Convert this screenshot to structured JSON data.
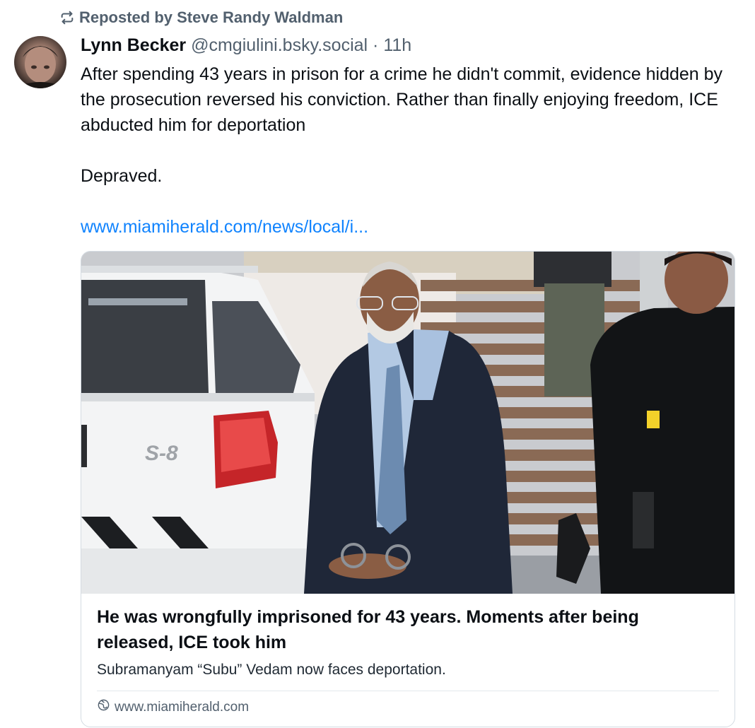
{
  "repost": {
    "label": "Reposted by Steve Randy Waldman",
    "icon": "repost-icon"
  },
  "post": {
    "author_name": "Lynn Becker",
    "handle": "@cmgiulini.bsky.social",
    "separator": "·",
    "time": "11h",
    "paragraphs": [
      "After spending 43 years in prison for a crime he didn't commit, evidence hidden by the prosecution reversed his conviction.  Rather than finally enjoying freedom, ICE abducted him for deportation",
      "Depraved."
    ],
    "link_text": "www.miamiherald.com/news/local/i..."
  },
  "card": {
    "title": "He was wrongfully imprisoned for 43 years. Moments after being released, ICE took him",
    "description": "Subramanyam “Subu” Vedam now faces deportation.",
    "domain": "www.miamiherald.com",
    "domain_icon": "globe-icon",
    "image_badge_text": "S-8"
  },
  "colors": {
    "text": "#0b0f14",
    "muted": "#52606e",
    "link": "#1083fe",
    "border": "#d4dbe2"
  }
}
